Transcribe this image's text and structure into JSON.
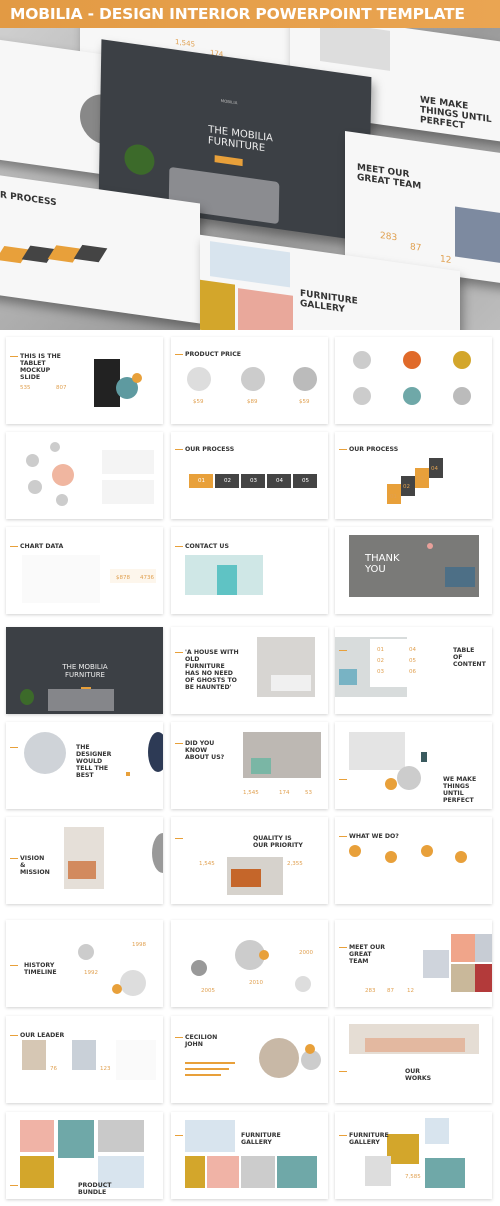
{
  "banner": {
    "title": "MOBILIA - DESIGN INTERIOR POWERPOINT TEMPLATE"
  },
  "colors": {
    "accent": "#e8a03a",
    "dark": "#3c4045",
    "banner": "#e39b46"
  },
  "hero": {
    "cover_title": "THE MOBILIA FURNITURE",
    "cover_brand": "MOBILIA",
    "about_stats": [
      "1,545",
      "174",
      "53"
    ],
    "perfect_title": "WE MAKE THINGS UNTIL PERFECT",
    "team_title": "MEET OUR GREAT TEAM",
    "team_stats": [
      "283",
      "87",
      "12"
    ],
    "process_title": "R PROCESS",
    "process_steps": [
      "01",
      "02",
      "03",
      "04"
    ],
    "gallery_title": "FURNITURE GALLERY"
  },
  "slides": [
    {
      "title": "THIS IS THE TABLET MOCKUP SLIDE",
      "stats": [
        "535",
        "807"
      ]
    },
    {
      "title": "PRODUCT PRICE",
      "stats": [
        "$59",
        "$89",
        "$59"
      ]
    },
    {
      "title": "",
      "stats": []
    },
    {
      "title": "",
      "stats": []
    },
    {
      "title": "OUR PROCESS",
      "stats": [
        "01",
        "02",
        "03",
        "04",
        "05"
      ]
    },
    {
      "title": "OUR PROCESS",
      "stats": [
        "01",
        "02",
        "03",
        "04"
      ]
    },
    {
      "title": "CHART DATA",
      "stats": [
        "$878",
        "4736"
      ]
    },
    {
      "title": "CONTACT US",
      "stats": []
    },
    {
      "title": "THANK YOU",
      "stats": []
    },
    {
      "title": "THE MOBILIA FURNITURE",
      "stats": []
    },
    {
      "title": "'A HOUSE WITH OLD FURNITURE HAS NO NEED OF GHOSTS TO BE HAUNTED'",
      "stats": []
    },
    {
      "title": "TABLE OF CONTENT",
      "stats": [
        "01",
        "02",
        "03",
        "04",
        "05",
        "06"
      ]
    },
    {
      "title": "THE DESIGNER WOULD TELL THE BEST",
      "stats": []
    },
    {
      "title": "DID YOU KNOW ABOUT US?",
      "stats": [
        "1,545",
        "174",
        "53"
      ]
    },
    {
      "title": "WE MAKE THINGS UNTIL PERFECT",
      "stats": []
    },
    {
      "title": "VISION & MISSION",
      "stats": []
    },
    {
      "title": "QUALITY IS OUR PRIORITY",
      "stats": [
        "1,545",
        "2,355"
      ]
    },
    {
      "title": "WHAT WE DO?",
      "stats": []
    },
    {
      "title": "HISTORY TIMELINE",
      "stats": [
        "1998",
        "1992"
      ]
    },
    {
      "title": "",
      "stats": [
        "2005",
        "2010",
        "2000"
      ]
    },
    {
      "title": "MEET OUR GREAT TEAM",
      "stats": [
        "283",
        "87",
        "12"
      ]
    },
    {
      "title": "OUR LEADER",
      "stats": [
        "76",
        "123"
      ]
    },
    {
      "title": "CECILION JOHN",
      "stats": []
    },
    {
      "title": "OUR WORKS",
      "stats": []
    },
    {
      "title": "PRODUCT BUNDLE",
      "stats": []
    },
    {
      "title": "FURNITURE GALLERY",
      "stats": []
    },
    {
      "title": "FURNITURE GALLERY",
      "stats": [
        "7,585"
      ]
    }
  ]
}
